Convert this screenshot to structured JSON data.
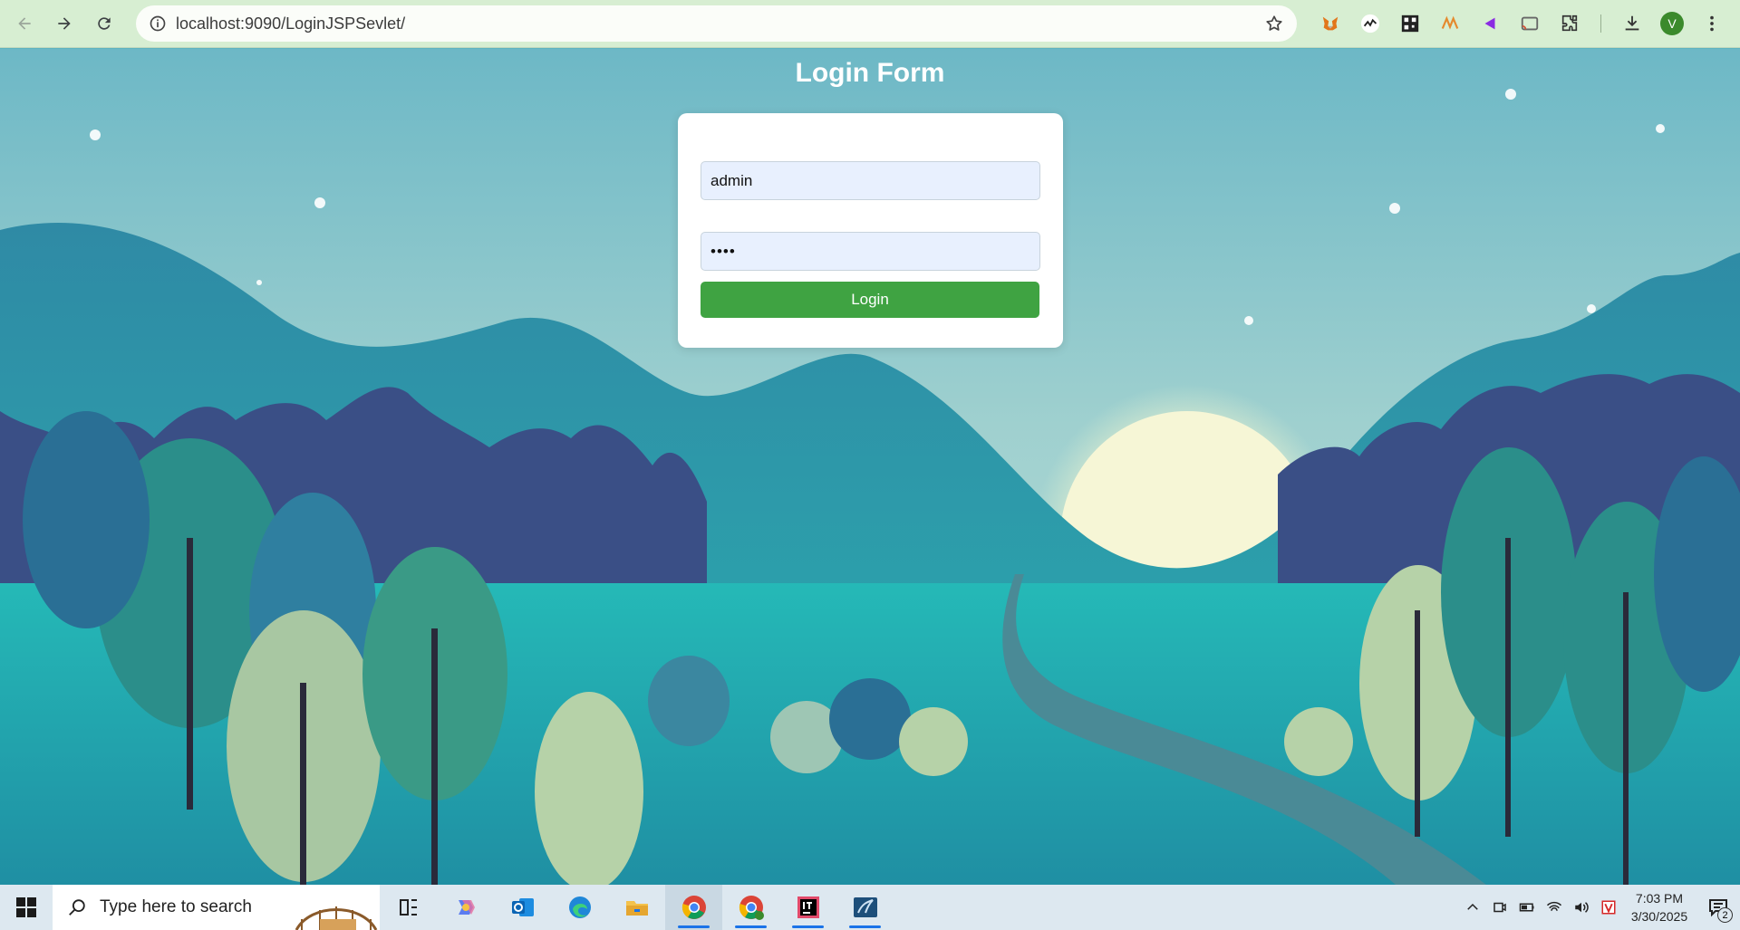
{
  "browser": {
    "url": "localhost:9090/LoginJSPSevlet/",
    "profile_initial": "V",
    "accent_color": "#d7eed2"
  },
  "page": {
    "title": "Login Form",
    "username_value": "admin",
    "password_value": "••••",
    "login_label": "Login",
    "button_color": "#3fa342"
  },
  "taskbar": {
    "search_placeholder": "Type here to search",
    "time": "7:03 PM",
    "date": "3/30/2025",
    "notification_count": "2",
    "apps": [
      "task-view",
      "copilot",
      "outlook",
      "edge",
      "file-explorer",
      "chrome",
      "chrome-profile",
      "intellij",
      "mysql-workbench"
    ]
  }
}
